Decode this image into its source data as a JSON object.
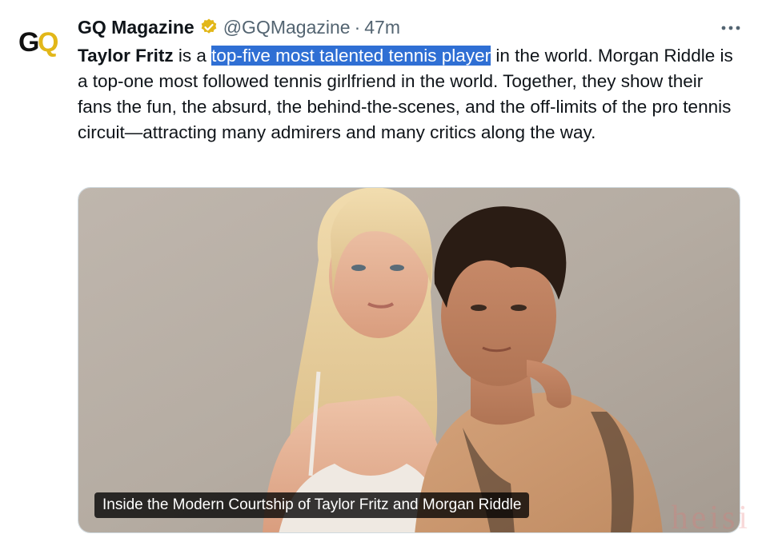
{
  "author": {
    "display_name": "GQ Magazine",
    "handle": "@GQMagazine",
    "separator": "·",
    "time": "47m",
    "avatar_logo": "GQ",
    "verified_color": "#e2b719"
  },
  "menu": {
    "more_icon": "more-horizontal-icon"
  },
  "tweet": {
    "bold_name": "Taylor Fritz",
    "text_before_highlight": " is a ",
    "highlighted_text": "top-five most talented tennis player",
    "text_after_highlight": " in the world. Morgan Riddle is a top-one most followed tennis girlfriend in the world. Together, they show their fans the fun, the absurd, the behind-the-scenes, and the off-limits of the pro tennis circuit—attracting many admirers and many critics along the way.",
    "highlight_color": "#2f6fd4"
  },
  "card": {
    "title": "Inside the Modern Courtship of Taylor Fritz and Morgan Riddle",
    "image_description_icon": "photo-couple-image"
  },
  "watermark": "heisi"
}
